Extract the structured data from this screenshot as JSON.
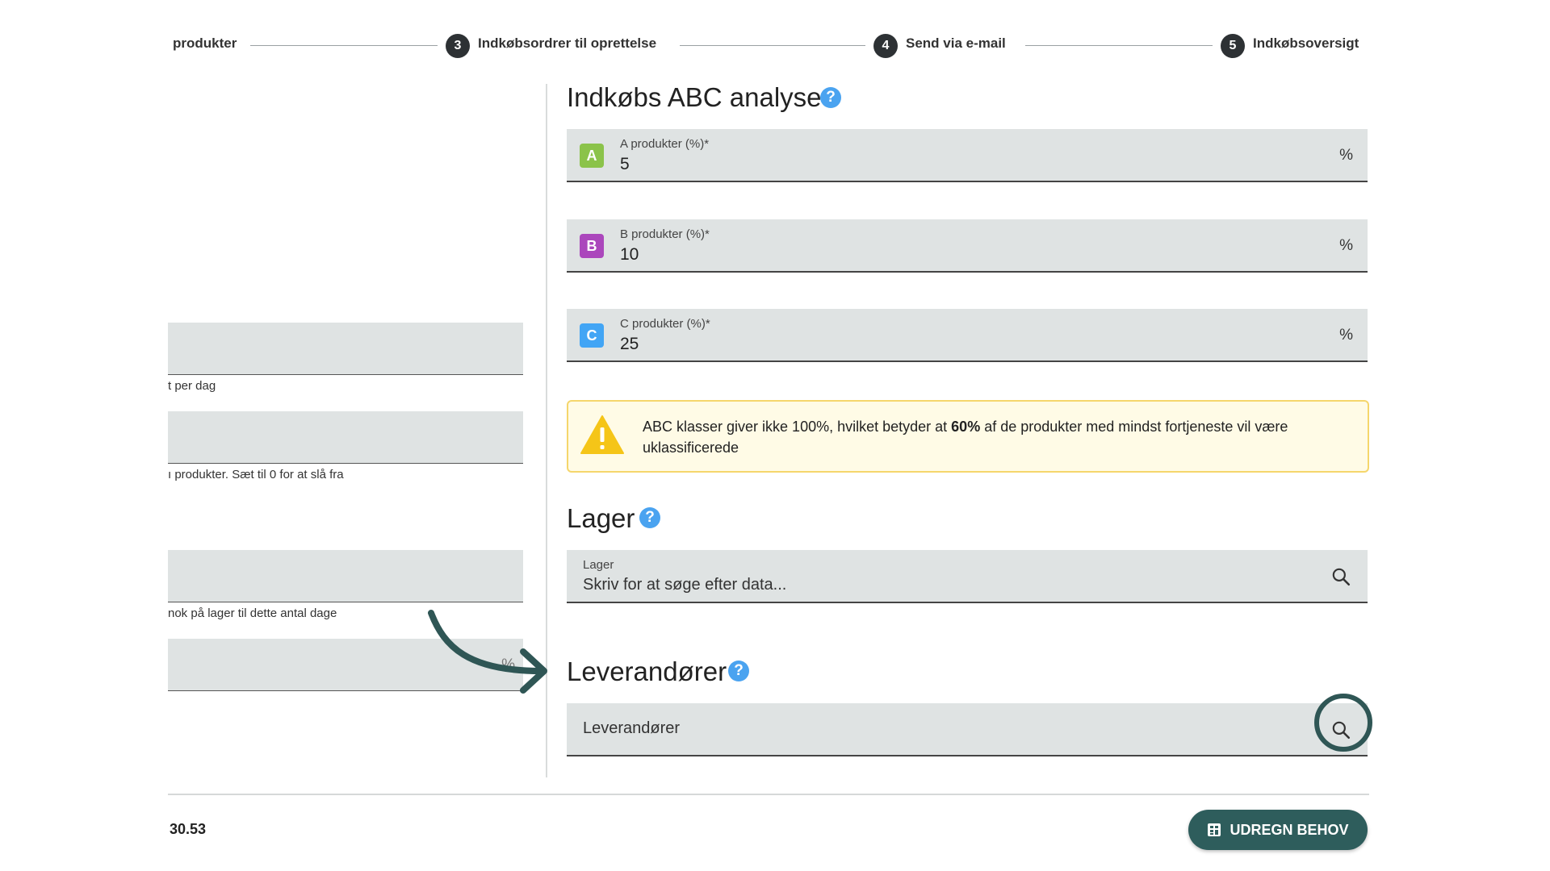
{
  "stepper": {
    "step2_label": "produkter",
    "step3_num": "3",
    "step3_label": "Indkøbsordrer til oprettelse",
    "step4_num": "4",
    "step4_label": "Send via e-mail",
    "step5_num": "5",
    "step5_label": "Indkøbsoversigt"
  },
  "left": {
    "hint1": "t per dag",
    "hint2": "ı produkter. Sæt til 0 for at slå fra",
    "hint3": "nok på lager til dette antal dage",
    "field4_suffix": "%"
  },
  "abc": {
    "title": "Indkøbs ABC analyse",
    "help": "?",
    "a": {
      "badge": "A",
      "label": "A produkter (%)*",
      "value": "5",
      "suffix": "%",
      "color": "#8bc34a"
    },
    "b": {
      "badge": "B",
      "label": "B produkter (%)*",
      "value": "10",
      "suffix": "%",
      "color": "#ab47bc"
    },
    "c": {
      "badge": "C",
      "label": "C produkter (%)*",
      "value": "25",
      "suffix": "%",
      "color": "#42a5f5"
    },
    "alert": {
      "pre": "ABC klasser giver ikke 100%, hvilket betyder at ",
      "bold": "60%",
      "post": " af de produkter med mindst fortjeneste vil være uklassificerede"
    }
  },
  "lager": {
    "title": "Lager",
    "help": "?",
    "field_label": "Lager",
    "placeholder": "Skriv for at søge efter data..."
  },
  "leverandorer": {
    "title": "Leverandører",
    "help": "?",
    "placeholder": "Leverandører"
  },
  "footer": {
    "value": "30.53",
    "button_label": "UDREGN BEHOV"
  },
  "colors": {
    "accent": "#2e5d5c",
    "help": "#4aa3f0",
    "warning": "#f5c518"
  }
}
